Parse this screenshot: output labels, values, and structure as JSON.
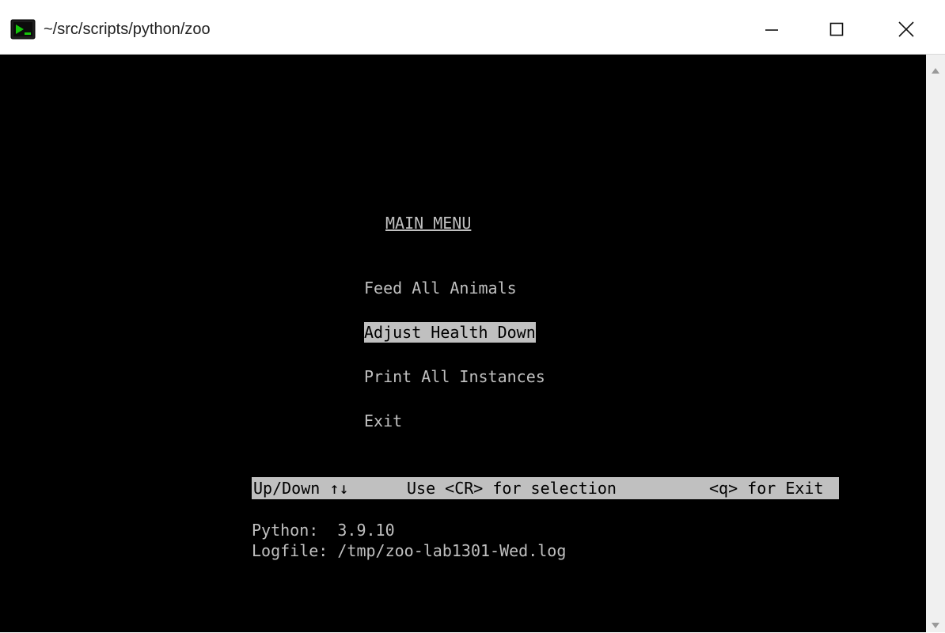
{
  "window": {
    "title": "~/src/scripts/python/zoo",
    "controls": {
      "minimize": "minimize",
      "maximize": "maximize",
      "close": "close"
    }
  },
  "terminal": {
    "menu_title": "MAIN MENU",
    "menu_items": [
      {
        "label": "Feed All Animals",
        "selected": false
      },
      {
        "label": "Adjust Health Down",
        "selected": true
      },
      {
        "label": "Print All Instances",
        "selected": false
      },
      {
        "label": "Exit",
        "selected": false
      }
    ],
    "status_bar": {
      "nav": "Up/Down ↑↓",
      "select": "Use <CR> for selection",
      "exit": "<q> for Exit"
    },
    "info": {
      "python_line": "Python:  3.9.10",
      "logfile_line": "Logfile: /tmp/zoo-lab1301-Wed.log"
    }
  },
  "colors": {
    "terminal_bg": "#000000",
    "terminal_fg": "#c0c0c0",
    "highlight_bg": "#c0c0c0",
    "icon_green": "#16c60c"
  }
}
